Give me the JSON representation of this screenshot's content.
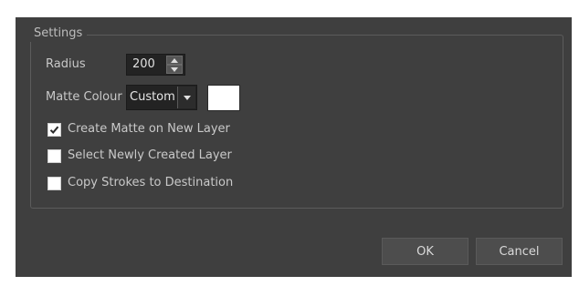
{
  "settings": {
    "group_title": "Settings",
    "radius": {
      "label": "Radius",
      "value": "200"
    },
    "matte_colour": {
      "label": "Matte Colour",
      "selected": "Custom",
      "swatch_color": "#ffffff"
    },
    "options": [
      {
        "label": "Create Matte on New Layer",
        "checked": true
      },
      {
        "label": "Select Newly Created Layer",
        "checked": false
      },
      {
        "label": "Copy Strokes to Destination",
        "checked": false
      }
    ]
  },
  "buttons": {
    "ok": "OK",
    "cancel": "Cancel"
  },
  "colors": {
    "dialog_background": "#3f3f3f",
    "text": "#c9c9c9"
  }
}
